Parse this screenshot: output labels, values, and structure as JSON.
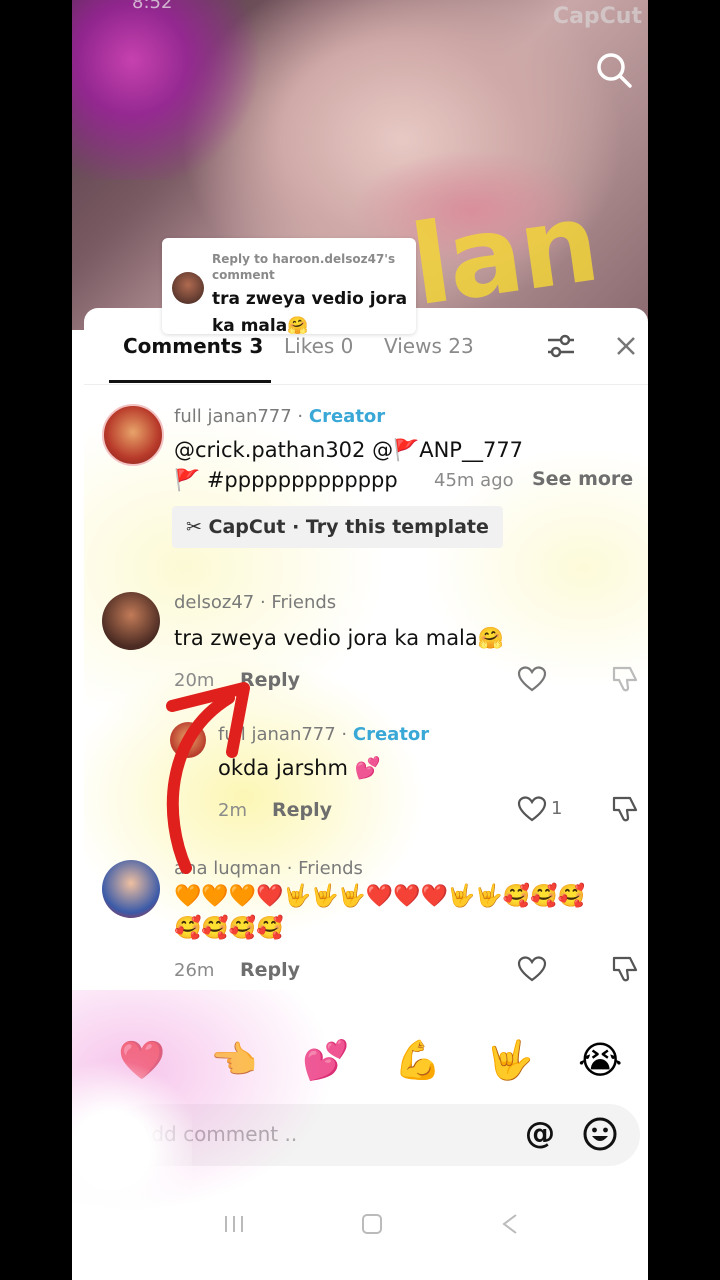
{
  "status_bar": {
    "time": "8:52"
  },
  "video": {
    "watermark": "CapCut",
    "overlay_text": "lan"
  },
  "reply_to": {
    "header": "Reply to haroon.delsoz47's comment",
    "text": "tra zweya vedio jora ka mala🤗"
  },
  "tabs": [
    {
      "label": "Comments 3"
    },
    {
      "label": "Likes 0"
    },
    {
      "label": "Views 23"
    }
  ],
  "comments": [
    {
      "username": "full janan777",
      "badge": "Creator",
      "line1": "@crick.pathan302 @🚩ANP__777",
      "line2": "🚩 #ppppppppppppp",
      "time": "45m ago",
      "see_more": "See more",
      "chip": "CapCut · Try this template"
    },
    {
      "username": "delsoz47",
      "badge": "Friends",
      "text": "tra zweya vedio jora ka mala🤗",
      "time": "20m",
      "reply": "Reply"
    },
    {
      "username": "full janan777",
      "badge": "Creator",
      "text": "okda jarshm 💕",
      "time": "2m",
      "reply": "Reply",
      "likes": "1"
    },
    {
      "username": "ana luqman",
      "badge": "Friends",
      "line1": "🧡🧡🧡❤️🤟🤟🤟❤️❤️❤️🤟🤟🥰🥰🥰",
      "line2": "🥰🥰🥰🥰",
      "time": "26m",
      "reply": "Reply"
    }
  ],
  "emoji_bar": [
    "❤️",
    "👈",
    "💕",
    "💪",
    "🤟",
    "😭"
  ],
  "input": {
    "placeholder": "Add comment ..",
    "at": "@"
  },
  "colors": {
    "creator": "#3aa8d6",
    "arrow": "#e0201c"
  }
}
